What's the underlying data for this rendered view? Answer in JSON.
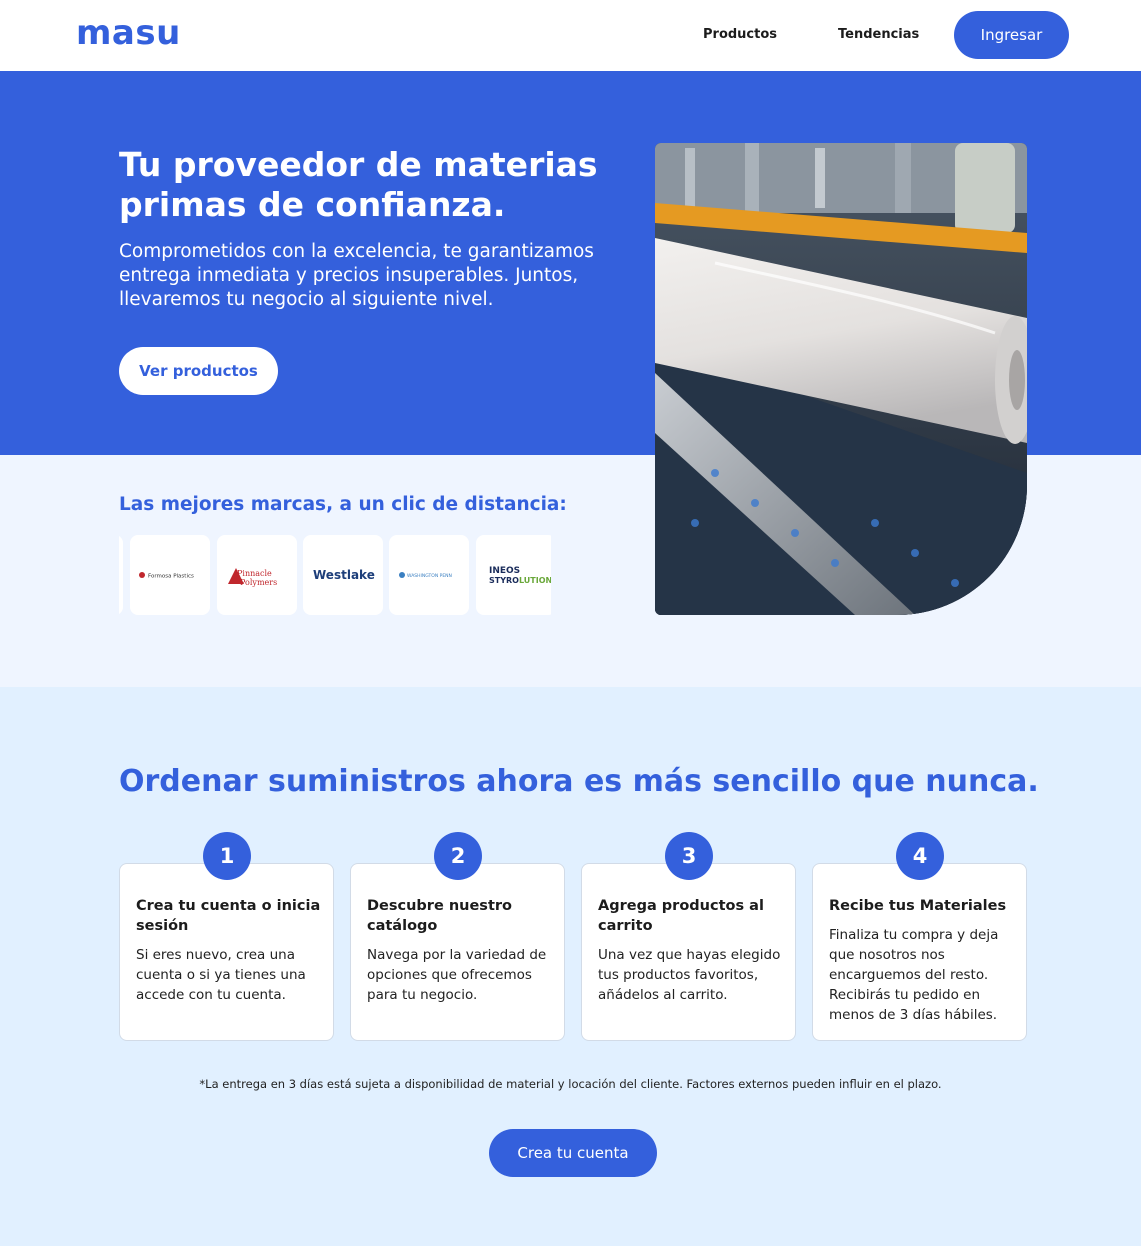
{
  "nav": {
    "logo": "masu",
    "links": [
      "Productos",
      "Tendencias"
    ],
    "login_label": "Ingresar"
  },
  "hero": {
    "title": "Tu proveedor de materias primas de confianza.",
    "subtitle": "Comprometidos con la excelencia, te garantizamos entrega inmediata y precios insuperables. Juntos, llevaremos tu negocio al siguiente nivel.",
    "cta_label": "Ver productos"
  },
  "brands": {
    "title": "Las mejores marcas, a un clic de distancia:",
    "logos": [
      "Formosa Plastics",
      "Pinnacle Polymers",
      "Westlake",
      "WASHINGTON PENN",
      "INEOS STYROLUTION"
    ]
  },
  "steps": {
    "title": "Ordenar suministros ahora es más sencillo que nunca.",
    "items": [
      {
        "number": "1",
        "title": "Crea tu cuenta o inicia sesión",
        "text": "Si eres nuevo, crea una cuenta o si ya tienes una accede con tu cuenta."
      },
      {
        "number": "2",
        "title": "Descubre nuestro catálogo",
        "text": "Navega por la variedad de opciones que ofrecemos para tu negocio."
      },
      {
        "number": "3",
        "title": "Agrega productos al carrito",
        "text": "Una vez que hayas elegido tus productos favoritos, añádelos al carrito."
      },
      {
        "number": "4",
        "title": "Recibe tus Materiales",
        "text": "Finaliza tu compra y deja que nosotros nos encarguemos del resto. Recibirás tu pedido en menos de 3 días hábiles."
      }
    ],
    "disclaimer": "*La entrega en 3 días está sujeta a disponibilidad de material y locación del cliente. Factores externos pueden influir en el plazo.",
    "cta_label": "Crea tu cuenta"
  },
  "colors": {
    "brand_blue": "#3460dc",
    "light_bg": "#eff5ff",
    "section_bg": "#e1f0ff"
  }
}
